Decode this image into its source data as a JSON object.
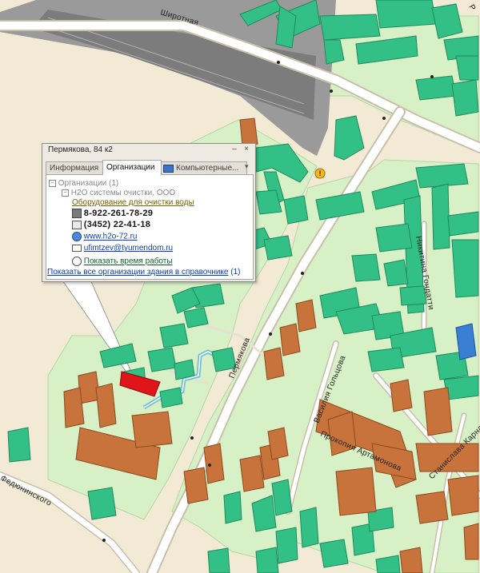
{
  "map": {
    "streets": [
      {
        "name": "Широтная"
      },
      {
        "name": "Пермякова"
      },
      {
        "name": "Василия Гольцова"
      },
      {
        "name": "Прокопия Артамонова"
      },
      {
        "name": "Станислава Карнацевича"
      },
      {
        "name": "Никитина Гондатти"
      },
      {
        "name": "Федюнинского"
      }
    ],
    "colors": {
      "background": "#f2ead4",
      "courtyard": "#d7f0c6",
      "building": "#33c087",
      "orange_building": "#c8733b",
      "selected_building": "#e0141b",
      "railway": "#8c8c8c",
      "road": "#ffffff",
      "route": "#9fd9e6"
    }
  },
  "popup": {
    "title": "Пермякова, 84 к2",
    "controls": {
      "minimize": "–",
      "close": "×"
    },
    "tabs": [
      {
        "label": "Информация",
        "active": false
      },
      {
        "label": "Организации",
        "active": true
      },
      {
        "label": "Компьютерные...",
        "active": false
      }
    ],
    "tab_scroll": "▾",
    "tree": {
      "organizations": "Организации (1)",
      "company": "H2O системы очистки, ООО",
      "category": "Оборудование для очистки воды",
      "phone1": "8-922-261-78-29",
      "phone2": "(3452) 22-41-18",
      "website": "www.h2o-72.ru",
      "email": "ufimtzev@tyumendom.ru",
      "hours_link": "Показать время работы"
    },
    "footer_link": "Показать все организации здания в справочнике",
    "footer_count": "(1)"
  }
}
